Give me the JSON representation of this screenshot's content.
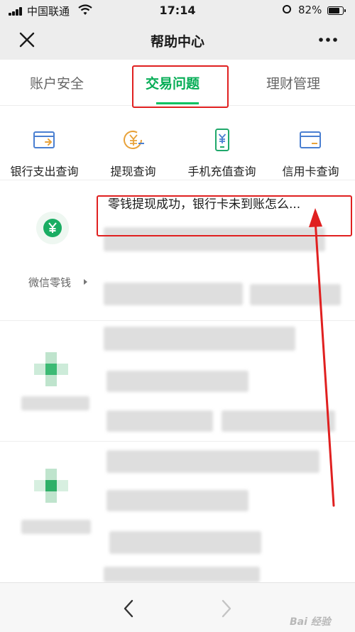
{
  "status_bar": {
    "carrier": "中国联通",
    "time": "17:14",
    "battery": "82%"
  },
  "nav": {
    "title": "帮助中心"
  },
  "tabs": [
    {
      "label": "账户安全",
      "active": false
    },
    {
      "label": "交易问题",
      "active": true
    },
    {
      "label": "理财管理",
      "active": false
    }
  ],
  "shortcuts": [
    {
      "label": "银行支出查询",
      "icon": "card-transfer-icon"
    },
    {
      "label": "提现查询",
      "icon": "yuan-clock-icon"
    },
    {
      "label": "手机充值查询",
      "icon": "phone-yuan-icon"
    },
    {
      "label": "信用卡查询",
      "icon": "credit-card-icon"
    }
  ],
  "wallet": {
    "label": "微信零钱",
    "faq": [
      "零钱提现成功，银行卡未到账怎么..."
    ]
  },
  "bottom_bar": {
    "watermark": "Bai 经验"
  },
  "colors": {
    "accent": "#07c160",
    "annotation": "#e02020",
    "header_bg": "#ededed"
  }
}
